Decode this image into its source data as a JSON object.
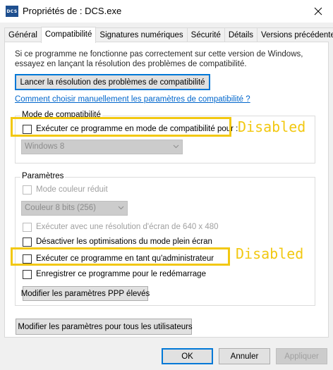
{
  "window": {
    "title": "Propriétés de : DCS.exe",
    "icon_text": "DCS"
  },
  "tabs": [
    {
      "label": "Général",
      "active": false
    },
    {
      "label": "Compatibilité",
      "active": true
    },
    {
      "label": "Signatures numériques",
      "active": false
    },
    {
      "label": "Sécurité",
      "active": false
    },
    {
      "label": "Détails",
      "active": false
    },
    {
      "label": "Versions précédentes",
      "active": false
    }
  ],
  "intro": {
    "line1": "Si ce programme ne fonctionne pas correctement sur cette version de Windows,",
    "line2": "essayez en lançant la résolution des problèmes de compatibilité."
  },
  "troubleshooter_button": "Lancer la résolution des problèmes de compatibilité",
  "manual_link": "Comment choisir manuellement les paramètres de compatibilité ?",
  "compat_mode": {
    "group_label": "Mode de compatibilité",
    "checkbox_label": "Exécuter ce programme en mode de compatibilité pour :",
    "checked": false,
    "os_select_value": "Windows 8"
  },
  "settings": {
    "group_label": "Paramètres",
    "reduced_color_label": "Mode couleur réduit",
    "color_select_value": "Couleur 8 bits (256)",
    "resolution_label": "Exécuter avec une résolution d'écran de 640 x 480",
    "fullscreen_opt_label": "Désactiver les optimisations du mode plein écran",
    "admin_label": "Exécuter ce programme en tant qu'administrateur",
    "restart_label": "Enregistrer ce programme pour le redémarrage",
    "dpi_button": "Modifier les paramètres PPP élevés"
  },
  "all_users_button": "Modifier les paramètres pour tous les utilisateurs",
  "footer": {
    "ok": "OK",
    "cancel": "Annuler",
    "apply": "Appliquer"
  },
  "annotations": {
    "compat_note": "Disabled",
    "admin_note": "Disabled",
    "color": "#f2c811"
  },
  "colors": {
    "link": "#0066cc",
    "focus_border": "#0078d7",
    "shield_blue": "#1f6fd1",
    "shield_yellow": "#f5c400"
  }
}
